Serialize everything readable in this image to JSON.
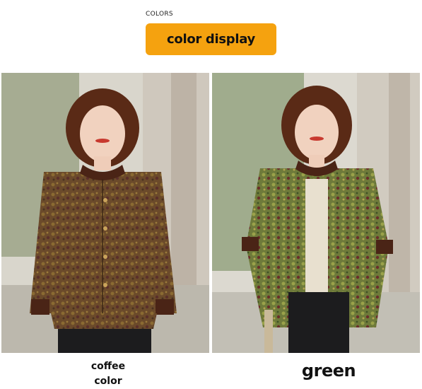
{
  "header": {
    "caption": "COLORS",
    "banner_label": "color display",
    "banner_color": "#f5a20f"
  },
  "variants": [
    {
      "label_line1": "coffee",
      "label_line2": "color",
      "swatch": "#6b4a2a"
    },
    {
      "label": "green",
      "swatch": "#6e7a3a"
    }
  ]
}
